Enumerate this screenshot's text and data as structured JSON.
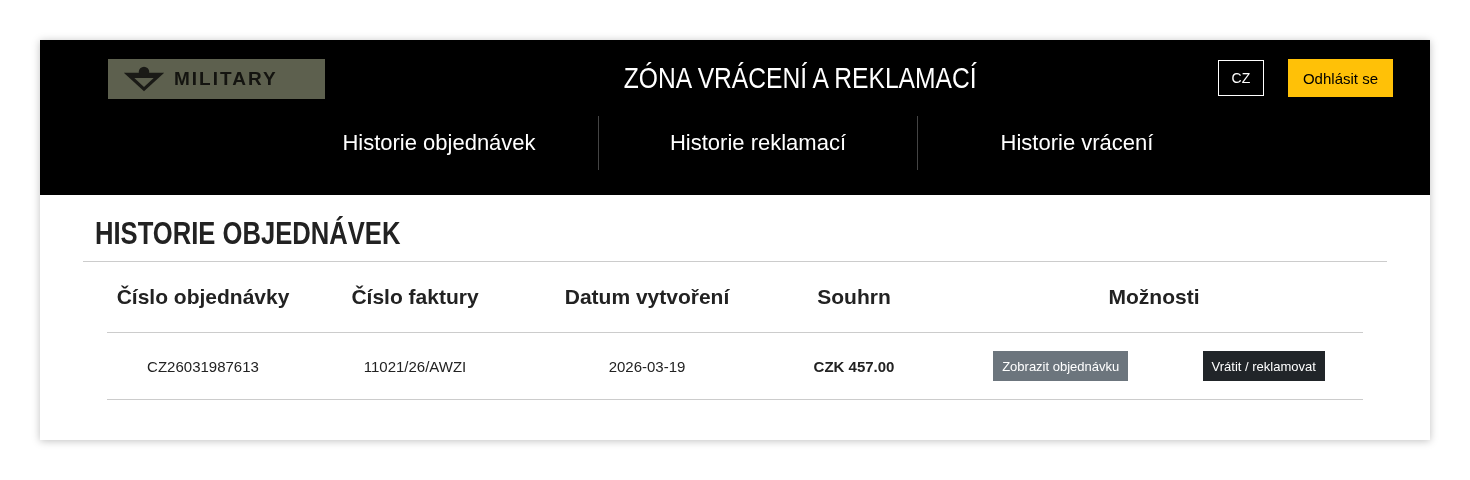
{
  "header": {
    "logo_text": "MILITARY",
    "title": "ZÓNA VRÁCENÍ A REKLAMACÍ",
    "language": "CZ",
    "logout": "Odhlásit se"
  },
  "nav": [
    {
      "label": "Historie objednávek"
    },
    {
      "label": "Historie reklamací"
    },
    {
      "label": "Historie vrácení"
    }
  ],
  "section_title": "HISTORIE OBJEDNÁVEK",
  "table": {
    "columns": [
      "Číslo objednávky",
      "Číslo faktury",
      "Datum vytvoření",
      "Souhrn",
      "Možnosti"
    ],
    "rows": [
      {
        "order": "CZ26031987613",
        "invoice": "11021/26/AWZI",
        "date": "2026-03-19",
        "total": "CZK 457.00",
        "actions": [
          {
            "label": "Zobrazit objednávku",
            "kind": "secondary"
          },
          {
            "label": "Vrátit / reklamovat",
            "kind": "dark"
          }
        ]
      }
    ]
  }
}
